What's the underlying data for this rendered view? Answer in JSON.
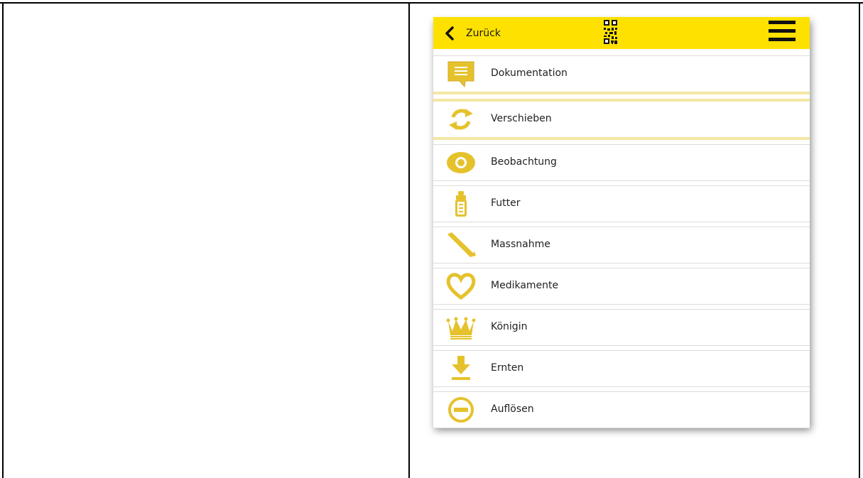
{
  "header": {
    "back_label": "Zurück",
    "background": "#ffe100",
    "icons": {
      "back": "chevron-left-icon",
      "qr": "qr-code-icon",
      "menu": "hamburger-menu-icon"
    }
  },
  "menu": {
    "accent_color": "#e5c22c",
    "items": [
      {
        "label": "Dokumentation",
        "icon": "speech-bubble-icon"
      },
      {
        "label": "Verschieben",
        "icon": "sync-arrows-icon"
      },
      {
        "label": "Beobachtung",
        "icon": "eye-icon"
      },
      {
        "label": "Futter",
        "icon": "bottle-icon"
      },
      {
        "label": "Massnahme",
        "icon": "hive-tool-icon"
      },
      {
        "label": "Medikamente",
        "icon": "heart-icon"
      },
      {
        "label": "Königin",
        "icon": "crown-icon"
      },
      {
        "label": "Ernten",
        "icon": "download-arrow-icon"
      },
      {
        "label": "Auflösen",
        "icon": "minus-circle-icon"
      }
    ]
  }
}
